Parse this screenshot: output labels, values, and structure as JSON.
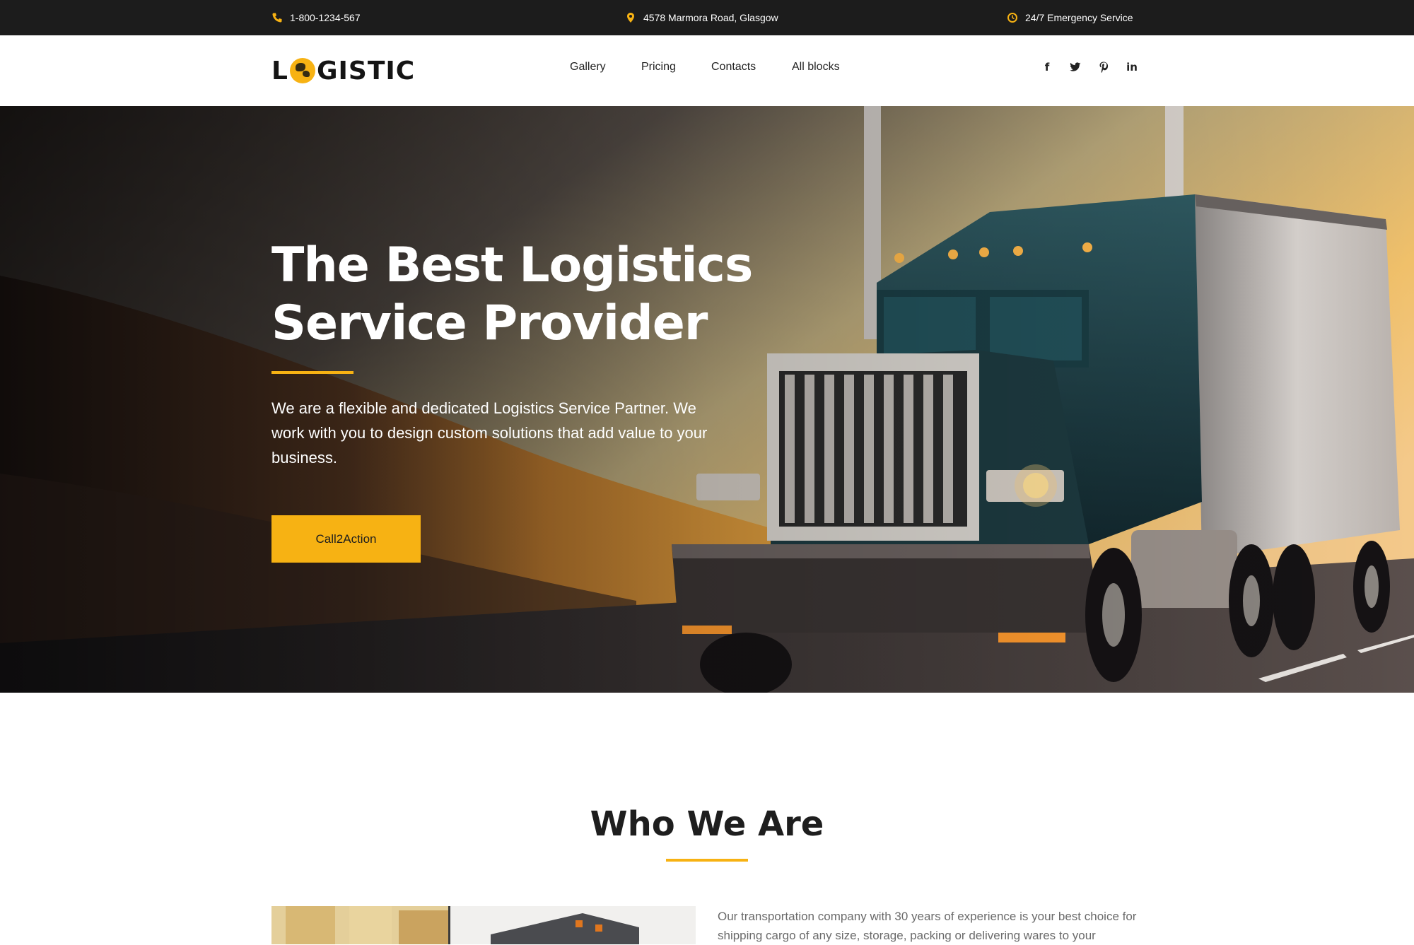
{
  "topbar": {
    "phone": "1-800-1234-567",
    "address": "4578 Marmora Road, Glasgow",
    "service": "24/7 Emergency Service",
    "phone_icon": "phone-icon",
    "address_icon": "map-pin-icon",
    "service_icon": "clock-icon"
  },
  "header": {
    "logo_left": "L",
    "logo_right": "GISTIC",
    "nav": [
      "Gallery",
      "Pricing",
      "Contacts",
      "All blocks"
    ],
    "social_icons": [
      "facebook-icon",
      "twitter-icon",
      "pinterest-icon",
      "linkedin-icon"
    ]
  },
  "hero": {
    "title_line1": "The Best Logistics",
    "title_line2": "Service Provider",
    "description": "We are a flexible and dedicated Logistics Service Partner. We work with you to design custom solutions that add value to your business.",
    "cta_label": "Call2Action"
  },
  "who": {
    "title": "Who We Are",
    "text": "Our transportation company with 30 years of experience is your best choice for shipping cargo of any size, storage, packing or delivering wares to your"
  },
  "colors": {
    "accent": "#f7b213",
    "topbar_bg": "#1c1c1c",
    "text_dark": "#1e1e1e",
    "text_muted": "#6a6a6a"
  }
}
